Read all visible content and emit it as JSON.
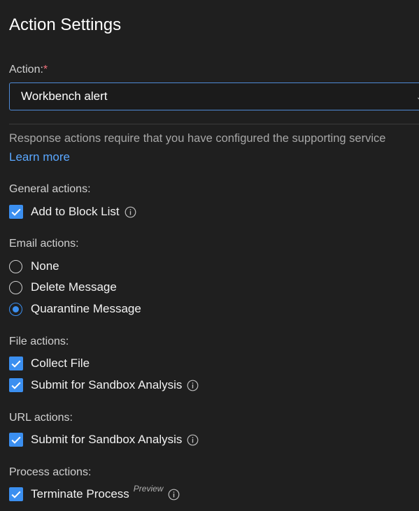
{
  "title": "Action Settings",
  "action_field": {
    "label": "Action:",
    "required_mark": "*",
    "value": "Workbench alert"
  },
  "info": {
    "text": "Response actions require that you have configured the supporting service",
    "learn_more": "Learn more"
  },
  "general": {
    "label": "General actions:",
    "items": [
      {
        "label": "Add to Block List",
        "checked": true
      }
    ]
  },
  "email": {
    "label": "Email actions:",
    "options": [
      {
        "label": "None",
        "selected": false
      },
      {
        "label": "Delete Message",
        "selected": false
      },
      {
        "label": "Quarantine Message",
        "selected": true
      }
    ]
  },
  "file": {
    "label": "File actions:",
    "items": [
      {
        "label": "Collect File",
        "checked": true
      },
      {
        "label": "Submit for Sandbox Analysis",
        "checked": true
      }
    ]
  },
  "url": {
    "label": "URL actions:",
    "items": [
      {
        "label": "Submit for Sandbox Analysis",
        "checked": true
      }
    ]
  },
  "process": {
    "label": "Process actions:",
    "items": [
      {
        "label": "Terminate Process",
        "checked": true,
        "badge": "Preview"
      }
    ]
  },
  "colors": {
    "accent": "#3b8ff0",
    "link": "#5aa7ff",
    "background": "#1f1f1f"
  }
}
